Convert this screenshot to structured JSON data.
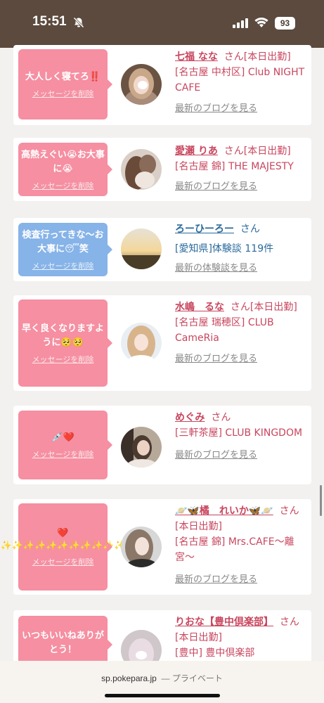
{
  "status": {
    "time": "15:51",
    "battery": "93",
    "icons": [
      "bell-slash-icon",
      "signal-icon",
      "wifi-icon",
      "battery-icon"
    ]
  },
  "cards": [
    {
      "message": "大人しく寝てろ‼️",
      "delete_label": "メッセージを削除",
      "name": "七福 なな",
      "suffix": "さん[本日出勤]",
      "shop": "[名古屋 中村区] Club NIGHT CAFE",
      "more": "最新のブログを見る",
      "bubble_color": "#f58fa1"
    },
    {
      "message": "高熱えぐい😭お大事に😭",
      "delete_label": "メッセージを削除",
      "name": "愛瀬 りあ",
      "suffix": "さん[本日出勤]",
      "shop": "[名古屋 錦] THE MAJESTY",
      "more": "最新のブログを見る",
      "bubble_color": "#f58fa1"
    },
    {
      "message": "検査行ってきな〜お大事に😴笑",
      "delete_label": "メッセージを削除",
      "name": "ろーひーろー",
      "suffix": "さん",
      "shop": "[愛知県]体験談 119件",
      "more": "最新の体験談を見る",
      "bubble_color": "#86b3e8"
    },
    {
      "message": "早く良くなりますように🥺🥺",
      "delete_label": "メッセージを削除",
      "name": "水嶋　るな",
      "suffix": "さん[本日出勤]",
      "shop": "[名古屋 瑞穂区] CLUB CameRia",
      "more": "最新のブログを見る",
      "bubble_color": "#f58fa1"
    },
    {
      "message": "💉❤️",
      "delete_label": "メッセージを削除",
      "name": "めぐみ",
      "suffix": "さん",
      "shop": "[三軒茶屋] CLUB KINGDOM",
      "more": "最新のブログを見る",
      "bubble_color": "#f58fa1"
    },
    {
      "message": "❤️ ✨✨✨✨✨✨✨✨✨✨✨",
      "delete_label": "メッセージを削除",
      "name": "🪐🦋橘　れいか🦋🪐",
      "suffix": "さん[本日出勤]",
      "shop": "[名古屋 錦] Mrs.CAFE〜離宮〜",
      "more": "最新のブログを見る",
      "bubble_color": "#f58fa1"
    },
    {
      "message": "いつもいいねありがとう！",
      "delete_label": "",
      "name": "りおな【豊中倶楽部】",
      "suffix": "さん[本日出勤]",
      "shop": "[豊中] 豊中倶楽部",
      "more": "",
      "bubble_color": "#f58fa1"
    }
  ],
  "browser": {
    "url": "sp.pokepara.jp",
    "mode": "— プライベート"
  }
}
